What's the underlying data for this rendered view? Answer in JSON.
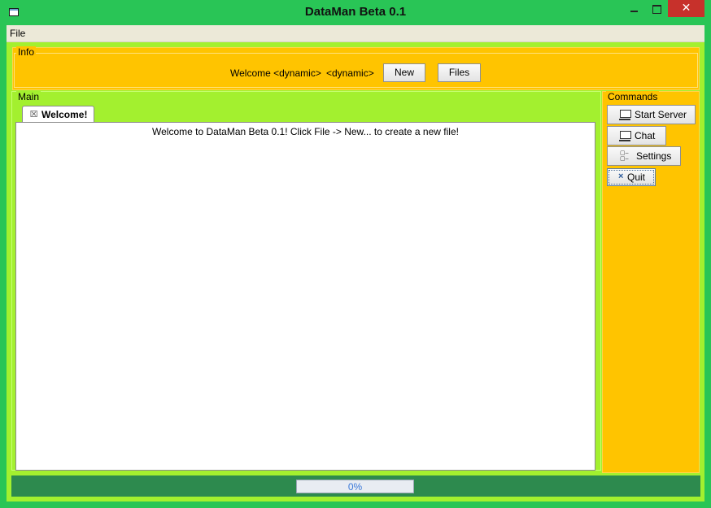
{
  "window": {
    "title": "DataMan Beta 0.1",
    "close_symbol": "✕"
  },
  "menu": {
    "file_label": "File"
  },
  "info": {
    "group_title": "Info",
    "welcome_text": "Welcome <dynamic>",
    "dynamic_text": "<dynamic>",
    "new_button": "New",
    "files_button": "Files"
  },
  "main": {
    "group_title": "Main",
    "tabs": [
      {
        "label": "Welcome!",
        "close_icon": "tab-close-icon"
      }
    ],
    "welcome_message": "Welcome to DataMan Beta 0.1! Click File -> New... to create a new file!"
  },
  "commands": {
    "group_title": "Commands",
    "buttons": [
      {
        "label": "Start Server",
        "icon": "monitor-icon"
      },
      {
        "label": "Chat",
        "icon": "monitor-icon"
      },
      {
        "label": "Settings",
        "icon": "list-icon"
      },
      {
        "label": "Quit",
        "icon": "close-icon"
      }
    ]
  },
  "status": {
    "progress_value": 0,
    "progress_text": "0%"
  },
  "colors": {
    "window_green": "#29c556",
    "panel_lime": "#a3f02f",
    "panel_amber": "#ffc400",
    "statusbar_green": "#2d8a4e",
    "close_red": "#c7312b",
    "progress_blue": "#3b79d8"
  }
}
